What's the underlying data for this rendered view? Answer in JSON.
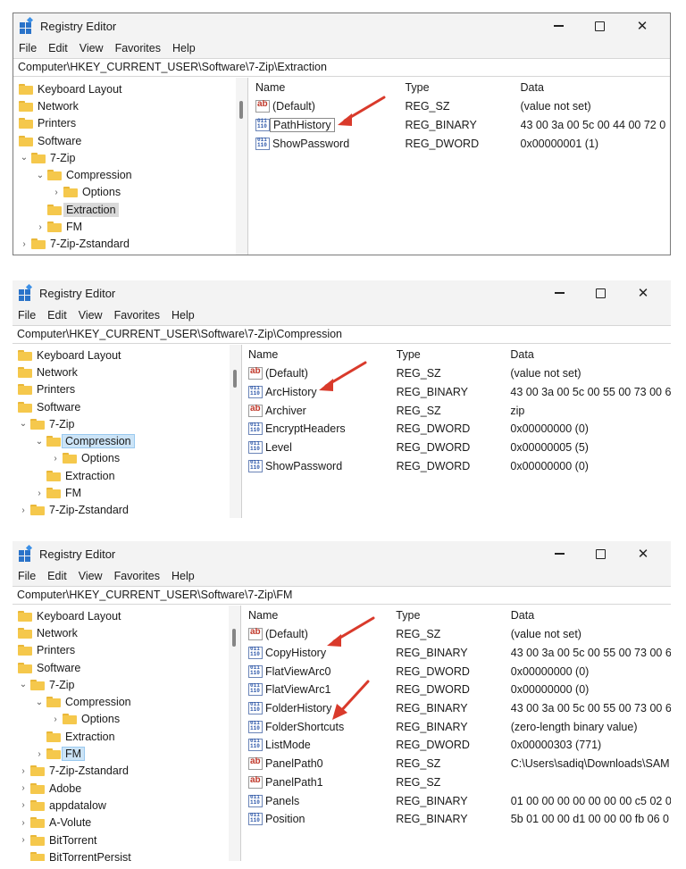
{
  "window": {
    "title": "Registry Editor"
  },
  "menu": [
    "File",
    "Edit",
    "View",
    "Favorites",
    "Help"
  ],
  "columns": {
    "name": "Name",
    "type": "Type",
    "data": "Data"
  },
  "panels": [
    {
      "address": "Computer\\HKEY_CURRENT_USER\\Software\\7-Zip\\Extraction",
      "tree": [
        {
          "label": "Keyboard Layout"
        },
        {
          "label": "Network"
        },
        {
          "label": "Printers"
        },
        {
          "label": "Software"
        },
        {
          "label": "7-Zip"
        },
        {
          "label": "Compression"
        },
        {
          "label": "Options"
        },
        {
          "label": "Extraction"
        },
        {
          "label": "FM"
        },
        {
          "label": "7-Zip-Zstandard"
        }
      ],
      "values": [
        {
          "name": "(Default)",
          "type": "REG_SZ",
          "data": "(value not set)"
        },
        {
          "name": "PathHistory",
          "type": "REG_BINARY",
          "data": "43 00 3a 00 5c 00 44 00 72 0"
        },
        {
          "name": "ShowPassword",
          "type": "REG_DWORD",
          "data": "0x00000001 (1)"
        }
      ]
    },
    {
      "address": "Computer\\HKEY_CURRENT_USER\\Software\\7-Zip\\Compression",
      "tree": [
        {
          "label": "Keyboard Layout"
        },
        {
          "label": "Network"
        },
        {
          "label": "Printers"
        },
        {
          "label": "Software"
        },
        {
          "label": "7-Zip"
        },
        {
          "label": "Compression"
        },
        {
          "label": "Options"
        },
        {
          "label": "Extraction"
        },
        {
          "label": "FM"
        },
        {
          "label": "7-Zip-Zstandard"
        }
      ],
      "values": [
        {
          "name": "(Default)",
          "type": "REG_SZ",
          "data": "(value not set)"
        },
        {
          "name": "ArcHistory",
          "type": "REG_BINARY",
          "data": "43 00 3a 00 5c 00 55 00 73 00 6"
        },
        {
          "name": "Archiver",
          "type": "REG_SZ",
          "data": "zip"
        },
        {
          "name": "EncryptHeaders",
          "type": "REG_DWORD",
          "data": "0x00000000 (0)"
        },
        {
          "name": "Level",
          "type": "REG_DWORD",
          "data": "0x00000005 (5)"
        },
        {
          "name": "ShowPassword",
          "type": "REG_DWORD",
          "data": "0x00000000 (0)"
        }
      ]
    },
    {
      "address": "Computer\\HKEY_CURRENT_USER\\Software\\7-Zip\\FM",
      "tree": [
        {
          "label": "Keyboard Layout"
        },
        {
          "label": "Network"
        },
        {
          "label": "Printers"
        },
        {
          "label": "Software"
        },
        {
          "label": "7-Zip"
        },
        {
          "label": "Compression"
        },
        {
          "label": "Options"
        },
        {
          "label": "Extraction"
        },
        {
          "label": "FM"
        },
        {
          "label": "7-Zip-Zstandard"
        },
        {
          "label": "Adobe"
        },
        {
          "label": "appdatalow"
        },
        {
          "label": "A-Volute"
        },
        {
          "label": "BitTorrent"
        },
        {
          "label": "BitTorrentPersist"
        }
      ],
      "values": [
        {
          "name": "(Default)",
          "type": "REG_SZ",
          "data": "(value not set)"
        },
        {
          "name": "CopyHistory",
          "type": "REG_BINARY",
          "data": "43 00 3a 00 5c 00 55 00 73 00 6"
        },
        {
          "name": "FlatViewArc0",
          "type": "REG_DWORD",
          "data": "0x00000000 (0)"
        },
        {
          "name": "FlatViewArc1",
          "type": "REG_DWORD",
          "data": "0x00000000 (0)"
        },
        {
          "name": "FolderHistory",
          "type": "REG_BINARY",
          "data": "43 00 3a 00 5c 00 55 00 73 00 6"
        },
        {
          "name": "FolderShortcuts",
          "type": "REG_BINARY",
          "data": "(zero-length binary value)"
        },
        {
          "name": "ListMode",
          "type": "REG_DWORD",
          "data": "0x00000303 (771)"
        },
        {
          "name": "PanelPath0",
          "type": "REG_SZ",
          "data": "C:\\Users\\sadiq\\Downloads\\SAM"
        },
        {
          "name": "PanelPath1",
          "type": "REG_SZ",
          "data": ""
        },
        {
          "name": "Panels",
          "type": "REG_BINARY",
          "data": "01 00 00 00 00 00 00 00 c5 02 0"
        },
        {
          "name": "Position",
          "type": "REG_BINARY",
          "data": "5b 01 00 00 d1 00 00 00 fb 06 0"
        }
      ]
    }
  ],
  "colors": {
    "accent": "#2a73c9",
    "folder": "#f5c84c",
    "arrow": "#d93a2b",
    "selection": "#cce4f7"
  }
}
